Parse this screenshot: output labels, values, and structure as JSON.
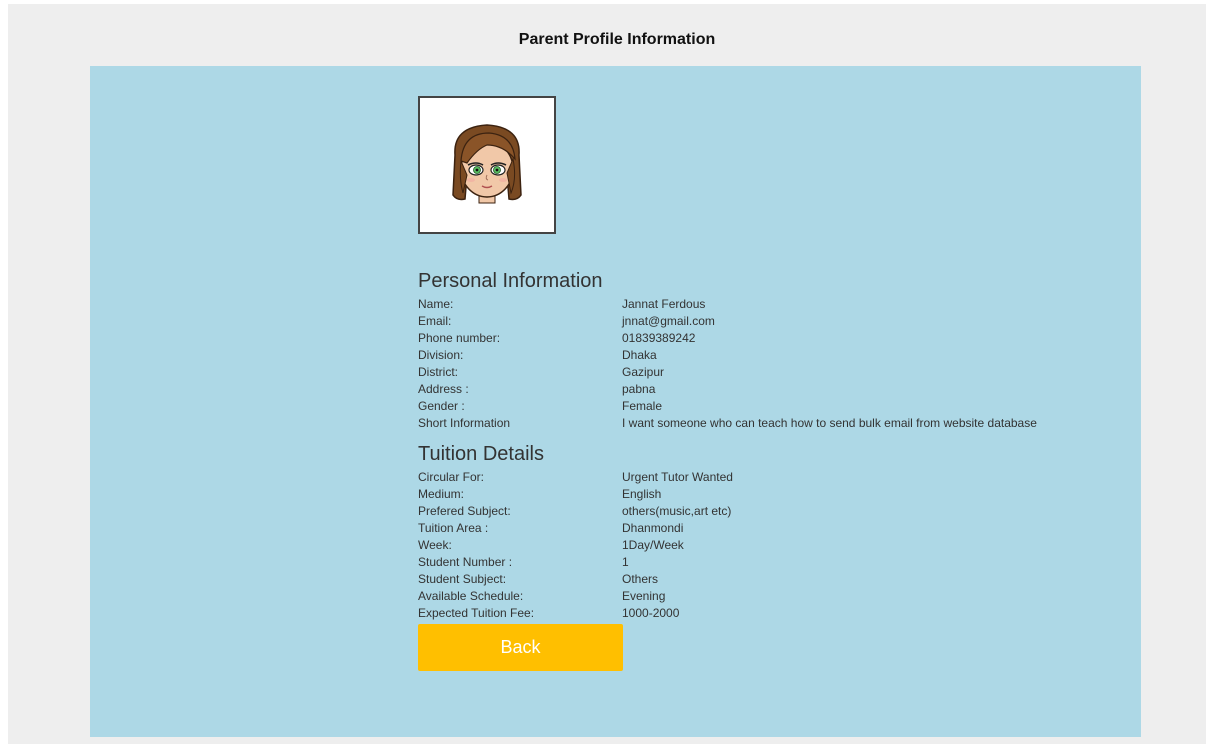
{
  "page": {
    "title": "Parent Profile Information"
  },
  "avatar": {
    "icon": "girl-cartoon-avatar",
    "hair_color": "#7a4a22",
    "skin_color": "#f1c8a8",
    "eye_color": "#5bbf63"
  },
  "personal": {
    "heading": "Personal Information",
    "rows": [
      {
        "label": "Name:",
        "value": "Jannat Ferdous"
      },
      {
        "label": "Email:",
        "value": "jnnat@gmail.com"
      },
      {
        "label": "Phone number:",
        "value": "01839389242"
      },
      {
        "label": "Division:",
        "value": "Dhaka"
      },
      {
        "label": "District:",
        "value": "Gazipur"
      },
      {
        "label": "Address :",
        "value": "pabna"
      },
      {
        "label": "Gender :",
        "value": "Female"
      },
      {
        "label": "Short Information",
        "value": "I want someone who can teach how to send bulk email from website database"
      }
    ]
  },
  "tuition": {
    "heading": "Tuition Details",
    "rows": [
      {
        "label": "Circular For:",
        "value": "Urgent Tutor Wanted"
      },
      {
        "label": "Medium:",
        "value": "English"
      },
      {
        "label": "Prefered Subject:",
        "value": "others(music,art etc)"
      },
      {
        "label": "Tuition Area :",
        "value": "Dhanmondi"
      },
      {
        "label": "Week:",
        "value": "1Day/Week"
      },
      {
        "label": "Student Number :",
        "value": "1"
      },
      {
        "label": "Student Subject:",
        "value": "Others"
      },
      {
        "label": "Available Schedule:",
        "value": "Evening"
      },
      {
        "label": "Expected Tuition Fee:",
        "value": "1000-2000"
      }
    ]
  },
  "actions": {
    "back_label": "Back"
  },
  "colors": {
    "page_bg": "#eeeeee",
    "panel_bg": "#add8e6",
    "button_bg": "#ffbf00",
    "button_text": "#ffffff"
  }
}
